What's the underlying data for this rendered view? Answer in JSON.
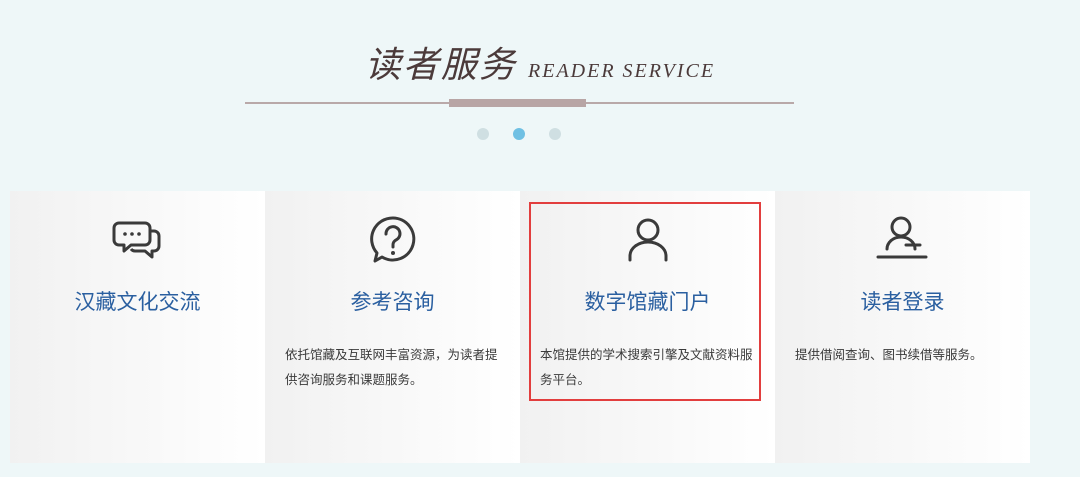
{
  "header": {
    "title_zh": "读者服务",
    "title_en": "READER SERVICE"
  },
  "carousel": {
    "dot_count": 3,
    "active_index": 1
  },
  "cards": [
    {
      "icon": "chat-bubbles-icon",
      "title": "汉藏文化交流",
      "desc": ""
    },
    {
      "icon": "question-bubble-icon",
      "title": "参考咨询",
      "desc": "依托馆藏及互联网丰富资源，为读者提供咨询服务和课题服务。"
    },
    {
      "icon": "user-icon",
      "title": "数字馆藏门户",
      "desc": "本馆提供的学术搜索引擎及文献资料服务平台。"
    },
    {
      "icon": "reader-login-icon",
      "title": "读者登录",
      "desc": "提供借阅查询、图书续借等服务。"
    }
  ],
  "colors": {
    "title_blue": "#2a5fa0",
    "highlight_red": "#e23e3e",
    "active_dot": "#6fc0e3",
    "background": "#eef7f8"
  }
}
